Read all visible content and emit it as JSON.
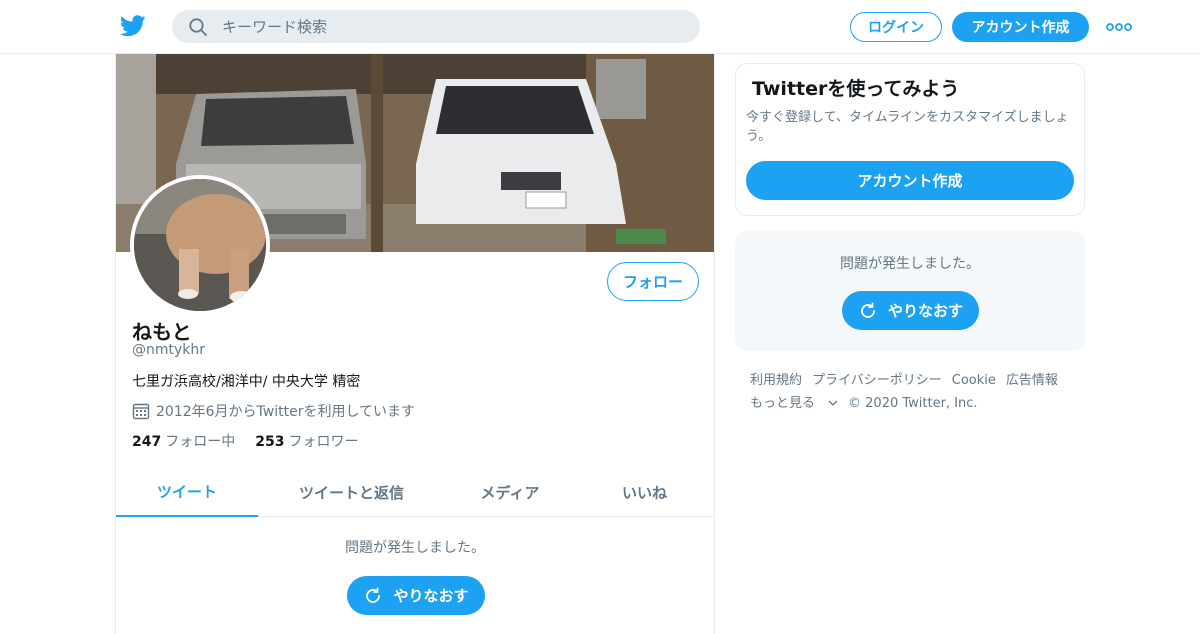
{
  "header": {
    "search_placeholder": "キーワード検索",
    "login_label": "ログイン",
    "signup_label": "アカウント作成"
  },
  "profile": {
    "name": "ねもと",
    "handle": "@nmtykhr",
    "bio": "七里ガ浜高校/湘洋中/ 中央大学 精密",
    "joined": "2012年6月からTwitterを利用しています",
    "following_count": "247",
    "following_label": "フォロー中",
    "followers_count": "253",
    "followers_label": "フォロワー",
    "follow_label": "フォロー"
  },
  "tabs": [
    {
      "label": "ツイート",
      "active": true
    },
    {
      "label": "ツイートと返信",
      "active": false
    },
    {
      "label": "メディア",
      "active": false
    },
    {
      "label": "いいね",
      "active": false
    }
  ],
  "timeline": {
    "error_message": "問題が発生しました。",
    "retry_label": "やりなおす"
  },
  "sidebar": {
    "signup_card": {
      "title": "Twitterを使ってみよう",
      "description": "今すぐ登録して、タイムラインをカスタマイズしましょう。",
      "button_label": "アカウント作成"
    },
    "error_box": {
      "message": "問題が発生しました。",
      "retry_label": "やりなおす"
    },
    "footer": {
      "links": [
        "利用規約",
        "プライバシーポリシー",
        "Cookie",
        "広告情報"
      ],
      "more_label": "もっと見る",
      "copyright": "© 2020 Twitter, Inc."
    }
  },
  "colors": {
    "brand": "#1da1f2",
    "secondary_text": "#657786",
    "border": "#e6ecf0"
  }
}
